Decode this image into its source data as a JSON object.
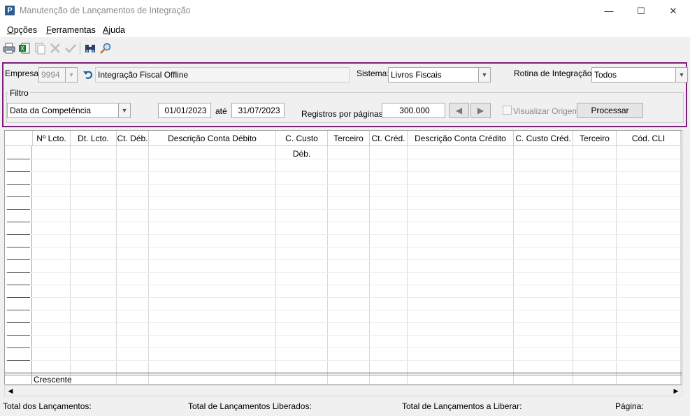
{
  "window": {
    "title": "Manutenção de Lançamentos de Integração",
    "app_icon_letter": "P",
    "controls": {
      "minimize": "—",
      "maximize": "☐",
      "close": "✕"
    }
  },
  "menu": [
    {
      "prefix": "",
      "accel": "O",
      "rest": "pções"
    },
    {
      "prefix": "",
      "accel": "F",
      "rest": "erramentas"
    },
    {
      "prefix": "",
      "accel": "A",
      "rest": "juda"
    }
  ],
  "toolbar": {
    "icons": [
      "printer-icon",
      "excel-export-icon",
      "copy-icon",
      "delete-icon",
      "confirm-icon",
      "binoculars-icon",
      "search-icon"
    ]
  },
  "filters": {
    "empresa_label": "Empresa:",
    "empresa_code": "9994",
    "empresa_name": "Integração Fiscal Offline",
    "sistema_label": "Sistema:",
    "sistema_value": "Livros Fiscais",
    "rotina_label": "Rotina de Integração:",
    "rotina_value": "Todos",
    "filtro_label": "Filtro",
    "date_type_value": "Data da Competência",
    "date_from": "01/01/2023",
    "ate_label": "até",
    "date_to": "31/07/2023",
    "registros_label": "Registros por páginas:",
    "registros_value": "300.000",
    "visualizar_label": "Visualizar Origem",
    "processar_label": "Processar"
  },
  "grid": {
    "columns": [
      "Nº Lcto.",
      "Dt. Lcto.",
      "Ct. Déb.",
      "Descrição Conta Débito",
      "C. Custo Déb.",
      "Terceiro",
      "Ct. Créd.",
      "Descrição Conta Crédito",
      "C. Custo Créd.",
      "Terceiro",
      "Cód. CLI"
    ],
    "footer_label": "Crescente"
  },
  "status": {
    "total_lancamentos": "Total dos Lançamentos:",
    "total_liberados": "Total de Lançamentos Liberados:",
    "total_a_liberar": "Total de Lançamentos a Liberar:",
    "pagina": "Página:"
  },
  "colors": {
    "panel_border": "#7a1f7a",
    "app_icon": "#2c5d8f"
  }
}
